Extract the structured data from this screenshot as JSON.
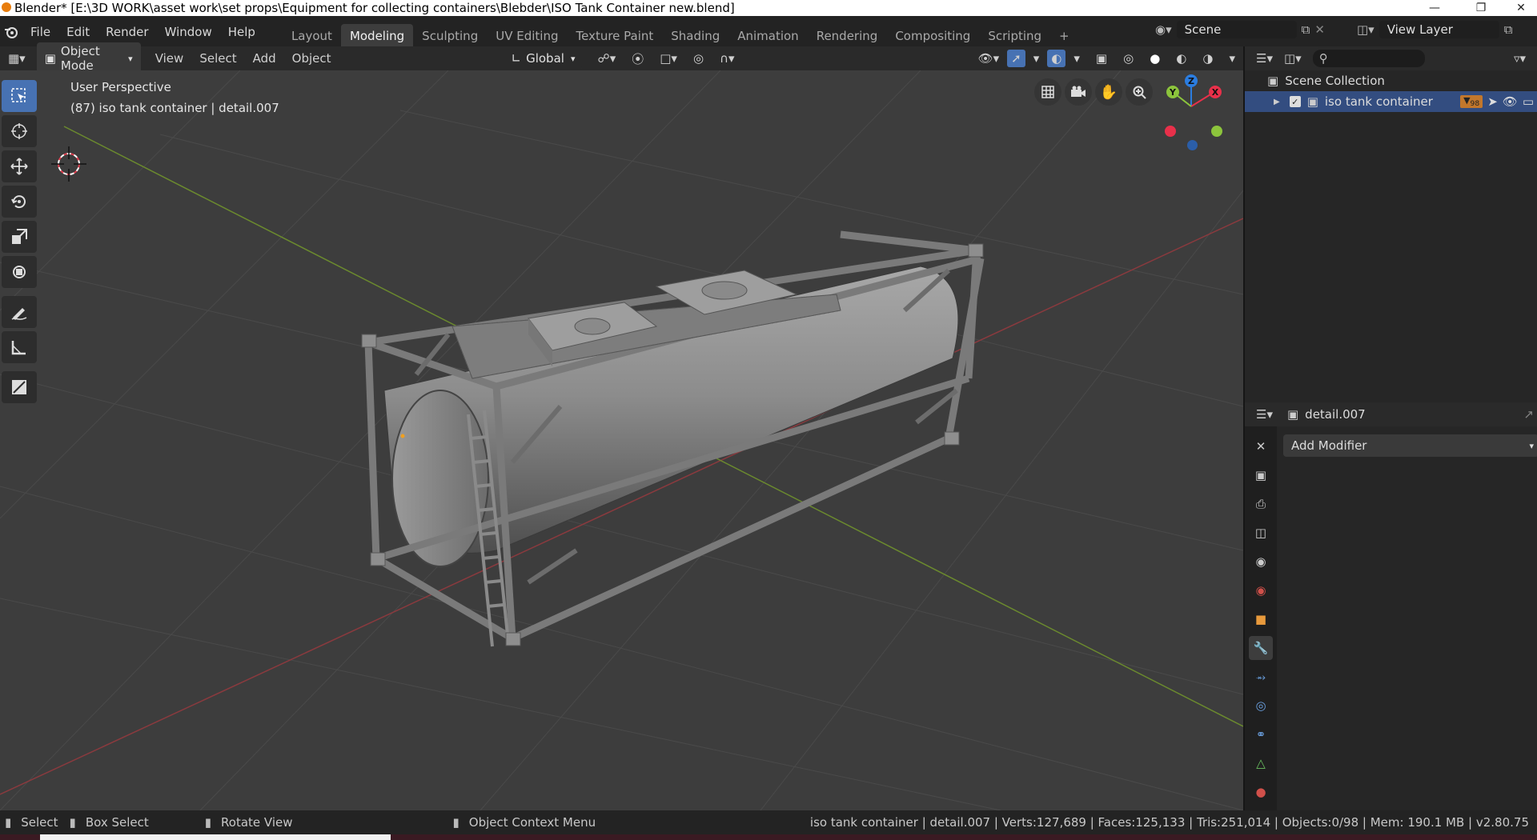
{
  "window": {
    "title": "Blender* [E:\\3D WORK\\asset work\\set props\\Equipment for collecting containers\\Blebder\\ISO Tank Container new.blend]"
  },
  "menu": [
    "File",
    "Edit",
    "Render",
    "Window",
    "Help"
  ],
  "workspaces": {
    "tabs": [
      "Layout",
      "Modeling",
      "Sculpting",
      "UV Editing",
      "Texture Paint",
      "Shading",
      "Animation",
      "Rendering",
      "Compositing",
      "Scripting"
    ],
    "active": "Modeling"
  },
  "scene": {
    "name": "Scene"
  },
  "view_layer": {
    "name": "View Layer"
  },
  "header": {
    "mode": "Object Mode",
    "menus": [
      "View",
      "Select",
      "Add",
      "Object"
    ],
    "orientation": "Global"
  },
  "viewport": {
    "perspective": "User Perspective",
    "info": "(87) iso tank container | detail.007",
    "gizmo": {
      "x": "X",
      "y": "Y",
      "z": "Z"
    },
    "colors": {
      "x": "#e8304a",
      "y": "#8cc43c",
      "z": "#2b7de0"
    }
  },
  "outliner": {
    "root": "Scene Collection",
    "collection": "iso tank container",
    "badge_count": "98"
  },
  "properties": {
    "object": "detail.007",
    "add_modifier": "Add Modifier"
  },
  "statusbar": {
    "select": "Select",
    "box_select": "Box Select",
    "rotate_view": "Rotate View",
    "context_menu": "Object Context Menu",
    "stats": "iso tank container | detail.007 | Verts:127,689 | Faces:125,133 | Tris:251,014 | Objects:0/98 | Mem: 190.1 MB | v2.80.75"
  },
  "colors": {
    "accent": "#4772b3",
    "active_tab": "#3d3d3d",
    "viewport_bg": "#3d3d3d"
  }
}
